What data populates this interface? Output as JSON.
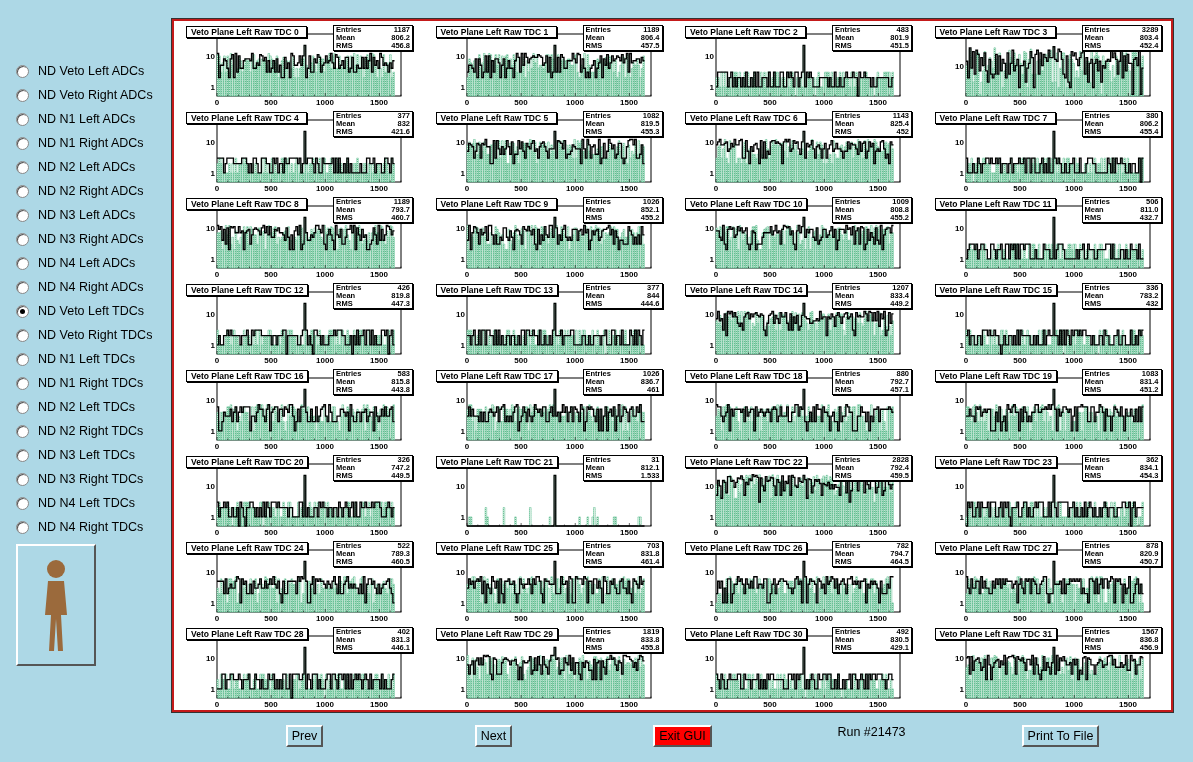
{
  "sidebar": {
    "options": [
      {
        "label": "ND Veto Left ADCs",
        "selected": false
      },
      {
        "label": "ND Veto Right ADCs",
        "selected": false
      },
      {
        "label": "ND N1 Left ADCs",
        "selected": false
      },
      {
        "label": "ND N1 Right ADCs",
        "selected": false
      },
      {
        "label": "ND N2 Left ADCs",
        "selected": false
      },
      {
        "label": "ND N2 Right ADCs",
        "selected": false
      },
      {
        "label": "ND N3 Left ADCs",
        "selected": false
      },
      {
        "label": "ND N3 Right ADCs",
        "selected": false
      },
      {
        "label": "ND N4 Left ADCs",
        "selected": false
      },
      {
        "label": "ND N4 Right ADCs",
        "selected": false
      },
      {
        "label": "ND Veto Left TDCs",
        "selected": true
      },
      {
        "label": "ND Veto Right TDCs",
        "selected": false
      },
      {
        "label": "ND N1 Left TDCs",
        "selected": false
      },
      {
        "label": "ND N1 Right TDCs",
        "selected": false
      },
      {
        "label": "ND N2 Left TDCs",
        "selected": false
      },
      {
        "label": "ND N2 Right TDCs",
        "selected": false
      },
      {
        "label": "ND N3 Left TDCs",
        "selected": false
      },
      {
        "label": "ND N3 Right TDCs",
        "selected": false
      },
      {
        "label": "ND N4 Left TDCs",
        "selected": false
      },
      {
        "label": "ND N4 Right TDCs",
        "selected": false
      }
    ],
    "image_button": {
      "kind": "figure"
    }
  },
  "histograms": [
    {
      "title": "Veto Plane Left Raw TDC 0",
      "kind": "dense",
      "stats": [
        {
          "label": "Entries",
          "value": "1187"
        },
        {
          "label": "Mean",
          "value": "806.2"
        },
        {
          "label": "RMS",
          "value": "456.8"
        }
      ],
      "x_ticks": [
        "0",
        "500",
        "1000",
        "1500"
      ],
      "y_ticks": [
        "10",
        "1"
      ]
    },
    {
      "title": "Veto Plane Left Raw TDC 1",
      "kind": "dense",
      "stats": [
        {
          "label": "Entries",
          "value": "1189"
        },
        {
          "label": "Mean",
          "value": "806.4"
        },
        {
          "label": "RMS",
          "value": "457.5"
        }
      ],
      "x_ticks": [
        "0",
        "500",
        "1000",
        "1500"
      ],
      "y_ticks": [
        "10",
        "1"
      ]
    },
    {
      "title": "Veto Plane Left Raw TDC 2",
      "kind": "sparse",
      "stats": [
        {
          "label": "Entries",
          "value": "483"
        },
        {
          "label": "Mean",
          "value": "801.9"
        },
        {
          "label": "RMS",
          "value": "451.5"
        }
      ],
      "x_ticks": [
        "0",
        "500",
        "1000",
        "1500"
      ],
      "y_ticks": [
        "10",
        "1"
      ]
    },
    {
      "title": "Veto Plane Left Raw TDC 3",
      "kind": "very_dense_raised",
      "stats": [
        {
          "label": "Entries",
          "value": "3289"
        },
        {
          "label": "Mean",
          "value": "803.4"
        },
        {
          "label": "RMS",
          "value": "452.4"
        }
      ],
      "x_ticks": [
        "0",
        "500",
        "1000",
        "1500"
      ],
      "y_ticks": [
        "10"
      ]
    },
    {
      "title": "Veto Plane Left Raw TDC 4",
      "kind": "sparse",
      "stats": [
        {
          "label": "Entries",
          "value": "377"
        },
        {
          "label": "Mean",
          "value": "832"
        },
        {
          "label": "RMS",
          "value": "421.6"
        }
      ],
      "x_ticks": [
        "0",
        "500",
        "1000",
        "1500"
      ],
      "y_ticks": [
        "10",
        "1"
      ]
    },
    {
      "title": "Veto Plane Left Raw TDC 5",
      "kind": "dense",
      "stats": [
        {
          "label": "Entries",
          "value": "1082"
        },
        {
          "label": "Mean",
          "value": "819.5"
        },
        {
          "label": "RMS",
          "value": "455.3"
        }
      ],
      "x_ticks": [
        "0",
        "500",
        "1000",
        "1500"
      ],
      "y_ticks": [
        "10",
        "1"
      ]
    },
    {
      "title": "Veto Plane Left Raw TDC 6",
      "kind": "dense",
      "stats": [
        {
          "label": "Entries",
          "value": "1143"
        },
        {
          "label": "Mean",
          "value": "825.4"
        },
        {
          "label": "RMS",
          "value": "452"
        }
      ],
      "x_ticks": [
        "0",
        "500",
        "1000",
        "1500"
      ],
      "y_ticks": [
        "10",
        "1"
      ]
    },
    {
      "title": "Veto Plane Left Raw TDC 7",
      "kind": "sparse",
      "stats": [
        {
          "label": "Entries",
          "value": "380"
        },
        {
          "label": "Mean",
          "value": "806.2"
        },
        {
          "label": "RMS",
          "value": "455.4"
        }
      ],
      "x_ticks": [
        "0",
        "500",
        "1000",
        "1500"
      ],
      "y_ticks": [
        "10",
        "1"
      ]
    },
    {
      "title": "Veto Plane Left Raw TDC 8",
      "kind": "dense",
      "stats": [
        {
          "label": "Entries",
          "value": "1189"
        },
        {
          "label": "Mean",
          "value": "793.7"
        },
        {
          "label": "RMS",
          "value": "460.7"
        }
      ],
      "x_ticks": [
        "0",
        "500",
        "1000",
        "1500"
      ],
      "y_ticks": [
        "10",
        "1"
      ]
    },
    {
      "title": "Veto Plane Left Raw TDC 9",
      "kind": "dense",
      "stats": [
        {
          "label": "Entries",
          "value": "1026"
        },
        {
          "label": "Mean",
          "value": "852.1"
        },
        {
          "label": "RMS",
          "value": "455.2"
        }
      ],
      "x_ticks": [
        "0",
        "500",
        "1000",
        "1500"
      ],
      "y_ticks": [
        "10",
        "1"
      ]
    },
    {
      "title": "Veto Plane Left Raw TDC 10",
      "kind": "dense",
      "stats": [
        {
          "label": "Entries",
          "value": "1009"
        },
        {
          "label": "Mean",
          "value": "808.8"
        },
        {
          "label": "RMS",
          "value": "455.2"
        }
      ],
      "x_ticks": [
        "0",
        "500",
        "1000",
        "1500"
      ],
      "y_ticks": [
        "10",
        "1"
      ]
    },
    {
      "title": "Veto Plane Left Raw TDC 11",
      "kind": "sparse",
      "stats": [
        {
          "label": "Entries",
          "value": "506"
        },
        {
          "label": "Mean",
          "value": "811.0"
        },
        {
          "label": "RMS",
          "value": "432.7"
        }
      ],
      "x_ticks": [
        "0",
        "500",
        "1000",
        "1500"
      ],
      "y_ticks": [
        "10",
        "1"
      ]
    },
    {
      "title": "Veto Plane Left Raw TDC 12",
      "kind": "sparse",
      "stats": [
        {
          "label": "Entries",
          "value": "426"
        },
        {
          "label": "Mean",
          "value": "819.8"
        },
        {
          "label": "RMS",
          "value": "447.3"
        }
      ],
      "x_ticks": [
        "0",
        "500",
        "1000",
        "1500"
      ],
      "y_ticks": [
        "10",
        "1"
      ]
    },
    {
      "title": "Veto Plane Left Raw TDC 13",
      "kind": "sparse",
      "stats": [
        {
          "label": "Entries",
          "value": "377"
        },
        {
          "label": "Mean",
          "value": "844"
        },
        {
          "label": "RMS",
          "value": "444.6"
        }
      ],
      "x_ticks": [
        "0",
        "500",
        "1000",
        "1500"
      ],
      "y_ticks": [
        "10",
        "1"
      ]
    },
    {
      "title": "Veto Plane Left Raw TDC 14",
      "kind": "dense",
      "stats": [
        {
          "label": "Entries",
          "value": "1207"
        },
        {
          "label": "Mean",
          "value": "833.4"
        },
        {
          "label": "RMS",
          "value": "449.2"
        }
      ],
      "x_ticks": [
        "0",
        "500",
        "1000",
        "1500"
      ],
      "y_ticks": [
        "10",
        "1"
      ]
    },
    {
      "title": "Veto Plane Left Raw TDC 15",
      "kind": "sparse",
      "stats": [
        {
          "label": "Entries",
          "value": "336"
        },
        {
          "label": "Mean",
          "value": "783.2"
        },
        {
          "label": "RMS",
          "value": "432"
        }
      ],
      "x_ticks": [
        "0",
        "500",
        "1000",
        "1500"
      ],
      "y_ticks": [
        "10",
        "1"
      ]
    },
    {
      "title": "Veto Plane Left Raw TDC 16",
      "kind": "medium",
      "stats": [
        {
          "label": "Entries",
          "value": "583"
        },
        {
          "label": "Mean",
          "value": "815.8"
        },
        {
          "label": "RMS",
          "value": "443.8"
        }
      ],
      "x_ticks": [
        "0",
        "500",
        "1000",
        "1500"
      ],
      "y_ticks": [
        "10",
        "1"
      ]
    },
    {
      "title": "Veto Plane Left Raw TDC 17",
      "kind": "medium",
      "stats": [
        {
          "label": "Entries",
          "value": "1026"
        },
        {
          "label": "Mean",
          "value": "836.7"
        },
        {
          "label": "RMS",
          "value": "461"
        }
      ],
      "x_ticks": [
        "0",
        "500",
        "1000",
        "1500"
      ],
      "y_ticks": [
        "10",
        "1"
      ]
    },
    {
      "title": "Veto Plane Left Raw TDC 18",
      "kind": "medium",
      "stats": [
        {
          "label": "Entries",
          "value": "880"
        },
        {
          "label": "Mean",
          "value": "792.7"
        },
        {
          "label": "RMS",
          "value": "457.1"
        }
      ],
      "x_ticks": [
        "0",
        "500",
        "1000",
        "1500"
      ],
      "y_ticks": [
        "10",
        "1"
      ]
    },
    {
      "title": "Veto Plane Left Raw TDC 19",
      "kind": "medium",
      "stats": [
        {
          "label": "Entries",
          "value": "1083"
        },
        {
          "label": "Mean",
          "value": "831.4"
        },
        {
          "label": "RMS",
          "value": "451.2"
        }
      ],
      "x_ticks": [
        "0",
        "500",
        "1000",
        "1500"
      ],
      "y_ticks": [
        "10",
        "1"
      ]
    },
    {
      "title": "Veto Plane Left Raw TDC 20",
      "kind": "sparse",
      "stats": [
        {
          "label": "Entries",
          "value": "326"
        },
        {
          "label": "Mean",
          "value": "747.2"
        },
        {
          "label": "RMS",
          "value": "449.5"
        }
      ],
      "x_ticks": [
        "0",
        "500",
        "1000",
        "1500"
      ],
      "y_ticks": [
        "10",
        "1"
      ]
    },
    {
      "title": "Veto Plane Left Raw TDC 21",
      "kind": "spike",
      "stats": [
        {
          "label": "Entries",
          "value": "31"
        },
        {
          "label": "Mean",
          "value": "812.1"
        },
        {
          "label": "RMS",
          "value": "1.533"
        }
      ],
      "x_ticks": [
        "0",
        "500",
        "1000",
        "1500"
      ],
      "y_ticks": [
        "10",
        "1"
      ]
    },
    {
      "title": "Veto Plane Left Raw TDC 22",
      "kind": "very_dense",
      "stats": [
        {
          "label": "Entries",
          "value": "2828"
        },
        {
          "label": "Mean",
          "value": "792.4"
        },
        {
          "label": "RMS",
          "value": "459.5"
        }
      ],
      "x_ticks": [
        "0",
        "500",
        "1000",
        "1500"
      ],
      "y_ticks": [
        "10",
        "1"
      ]
    },
    {
      "title": "Veto Plane Left Raw TDC 23",
      "kind": "sparse",
      "stats": [
        {
          "label": "Entries",
          "value": "362"
        },
        {
          "label": "Mean",
          "value": "834.1"
        },
        {
          "label": "RMS",
          "value": "454.3"
        }
      ],
      "x_ticks": [
        "0",
        "500",
        "1000",
        "1500"
      ],
      "y_ticks": [
        "10",
        "1"
      ]
    },
    {
      "title": "Veto Plane Left Raw TDC 24",
      "kind": "medium",
      "stats": [
        {
          "label": "Entries",
          "value": "522"
        },
        {
          "label": "Mean",
          "value": "789.3"
        },
        {
          "label": "RMS",
          "value": "460.5"
        }
      ],
      "x_ticks": [
        "0",
        "500",
        "1000",
        "1500"
      ],
      "y_ticks": [
        "10",
        "1"
      ]
    },
    {
      "title": "Veto Plane Left Raw TDC 25",
      "kind": "medium",
      "stats": [
        {
          "label": "Entries",
          "value": "703"
        },
        {
          "label": "Mean",
          "value": "831.8"
        },
        {
          "label": "RMS",
          "value": "461.4"
        }
      ],
      "x_ticks": [
        "0",
        "500",
        "1000",
        "1500"
      ],
      "y_ticks": [
        "10",
        "1"
      ]
    },
    {
      "title": "Veto Plane Left Raw TDC 26",
      "kind": "medium",
      "stats": [
        {
          "label": "Entries",
          "value": "782"
        },
        {
          "label": "Mean",
          "value": "794.7"
        },
        {
          "label": "RMS",
          "value": "464.5"
        }
      ],
      "x_ticks": [
        "0",
        "500",
        "1000",
        "1500"
      ],
      "y_ticks": [
        "10",
        "1"
      ]
    },
    {
      "title": "Veto Plane Left Raw TDC 27",
      "kind": "medium",
      "stats": [
        {
          "label": "Entries",
          "value": "878"
        },
        {
          "label": "Mean",
          "value": "820.9"
        },
        {
          "label": "RMS",
          "value": "450.7"
        }
      ],
      "x_ticks": [
        "0",
        "500",
        "1000",
        "1500"
      ],
      "y_ticks": [
        "10",
        "1"
      ]
    },
    {
      "title": "Veto Plane Left Raw TDC 28",
      "kind": "sparse",
      "stats": [
        {
          "label": "Entries",
          "value": "402"
        },
        {
          "label": "Mean",
          "value": "831.3"
        },
        {
          "label": "RMS",
          "value": "446.1"
        }
      ],
      "x_ticks": [
        "0",
        "500",
        "1000",
        "1500"
      ],
      "y_ticks": [
        "10",
        "1"
      ]
    },
    {
      "title": "Veto Plane Left Raw TDC 29",
      "kind": "dense",
      "stats": [
        {
          "label": "Entries",
          "value": "1819"
        },
        {
          "label": "Mean",
          "value": "833.8"
        },
        {
          "label": "RMS",
          "value": "455.8"
        }
      ],
      "x_ticks": [
        "0",
        "500",
        "1000",
        "1500"
      ],
      "y_ticks": [
        "10",
        "1"
      ]
    },
    {
      "title": "Veto Plane Left Raw TDC 30",
      "kind": "sparse",
      "stats": [
        {
          "label": "Entries",
          "value": "492"
        },
        {
          "label": "Mean",
          "value": "830.5"
        },
        {
          "label": "RMS",
          "value": "429.1"
        }
      ],
      "x_ticks": [
        "0",
        "500",
        "1000",
        "1500"
      ],
      "y_ticks": [
        "10",
        "1"
      ]
    },
    {
      "title": "Veto Plane Left Raw TDC 31",
      "kind": "dense",
      "stats": [
        {
          "label": "Entries",
          "value": "1567"
        },
        {
          "label": "Mean",
          "value": "836.8"
        },
        {
          "label": "RMS",
          "value": "456.9"
        }
      ],
      "x_ticks": [
        "0",
        "500",
        "1000",
        "1500"
      ],
      "y_ticks": [
        "10",
        "1"
      ]
    }
  ],
  "footer": [
    {
      "kind": "button",
      "label": "Prev"
    },
    {
      "kind": "button",
      "label": "Next"
    },
    {
      "kind": "alert_button",
      "label": "Exit GUI"
    },
    {
      "kind": "text",
      "label": "Run #21473"
    },
    {
      "kind": "button",
      "label": "Print To File"
    }
  ]
}
